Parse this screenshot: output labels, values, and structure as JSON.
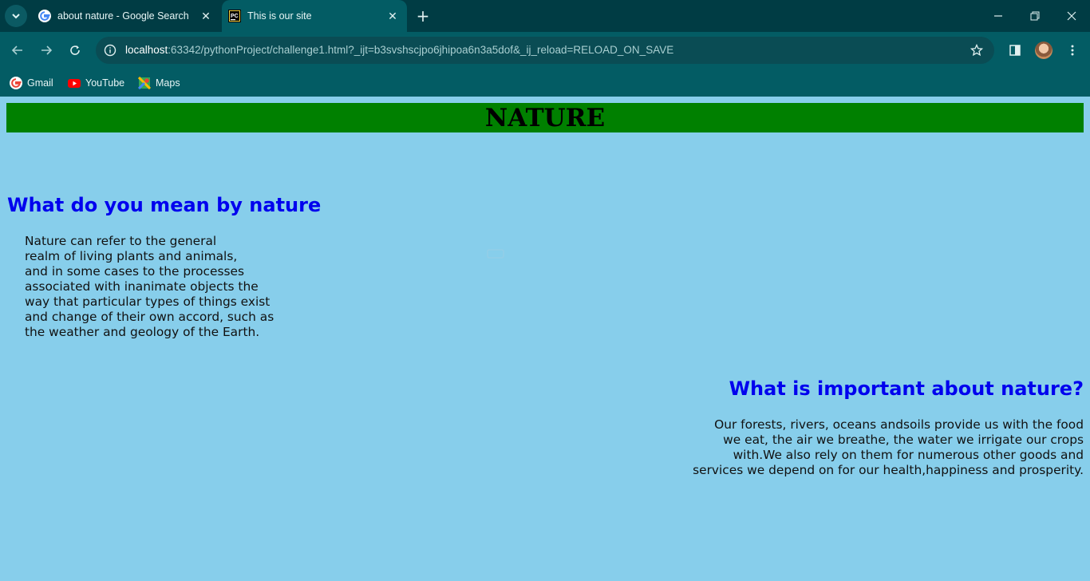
{
  "browser": {
    "tabs": [
      {
        "title": "about nature - Google Search",
        "active": false,
        "favicon": "google-icon"
      },
      {
        "title": "This is our site",
        "active": true,
        "favicon": "pycharm-icon"
      }
    ],
    "address": {
      "host": "localhost",
      "rest": ":63342/pythonProject/challenge1.html?_ijt=b3svshscjpo6jhipoa6n3a5dof&_ij_reload=RELOAD_ON_SAVE"
    },
    "bookmarks": [
      {
        "label": "Gmail",
        "icon": "google-icon"
      },
      {
        "label": "YouTube",
        "icon": "youtube-icon"
      },
      {
        "label": "Maps",
        "icon": "maps-icon"
      }
    ],
    "colors": {
      "tabbar": "#003c44",
      "toolbar": "#035c64"
    }
  },
  "page": {
    "heading": "NATURE",
    "section1": {
      "title": "What do you mean by nature",
      "text": "Nature can refer to the general\nrealm of living plants and animals,\nand in some cases to the processes\nassociated with inanimate objects the\nway that particular types of things exist\nand change of their own accord, such as\nthe weather and geology of the Earth."
    },
    "section2": {
      "title": "What is important about nature?",
      "text": "Our forests, rivers, oceans andsoils provide us with the food\nwe eat, the air we breathe,  the water we irrigate our crops\nwith.We also rely on them for numerous other goods and\nservices we depend on for our health,happiness and prosperity."
    },
    "colors": {
      "background": "#87ceeb",
      "banner": "#008000",
      "heading_link": "#0000ee"
    }
  }
}
